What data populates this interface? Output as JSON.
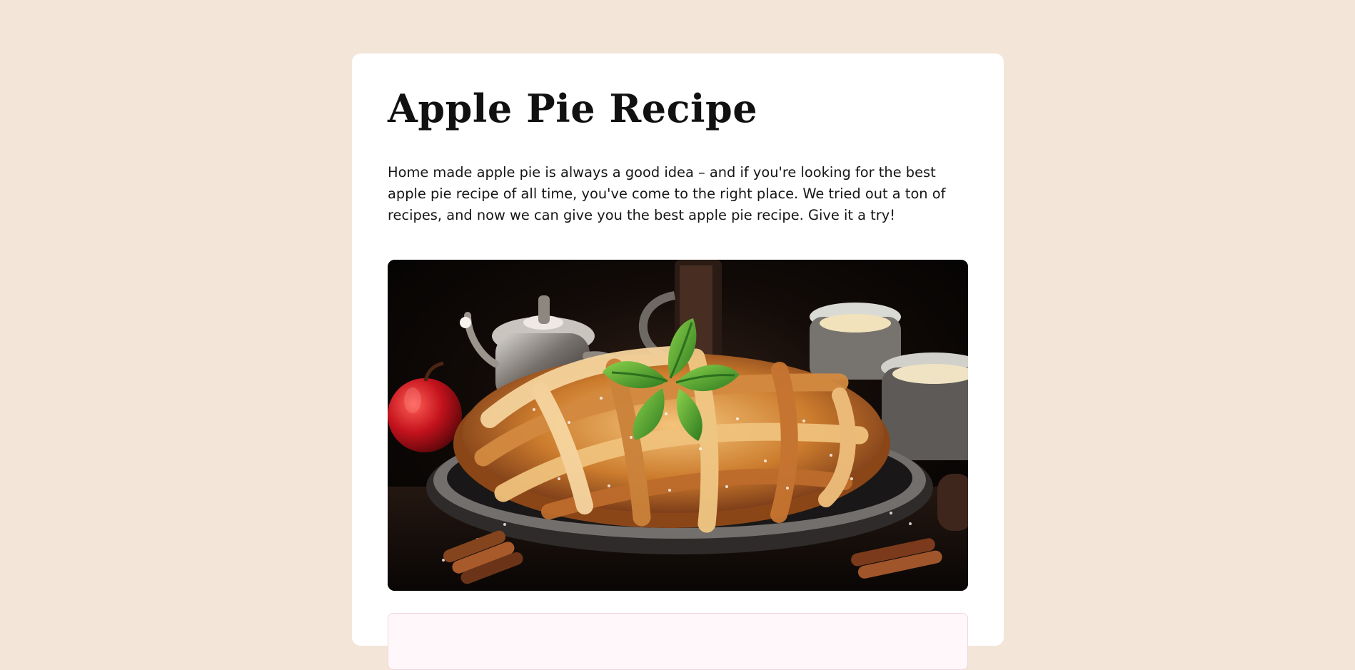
{
  "recipe": {
    "title": "Apple Pie Recipe",
    "intro": "Home made apple pie is always a good idea – and if you're looking for the best apple pie recipe of all time, you've come to the right place. We tried out a ton of recipes, and now we can give you the best apple pie recipe. Give it a try!"
  },
  "hero_image": {
    "icon_name": "apple-pie-photo"
  },
  "colors": {
    "background": "#f3e5d8",
    "card": "#ffffff",
    "preparation_box": "#fff7fa",
    "preparation_border": "#f0d6df"
  }
}
